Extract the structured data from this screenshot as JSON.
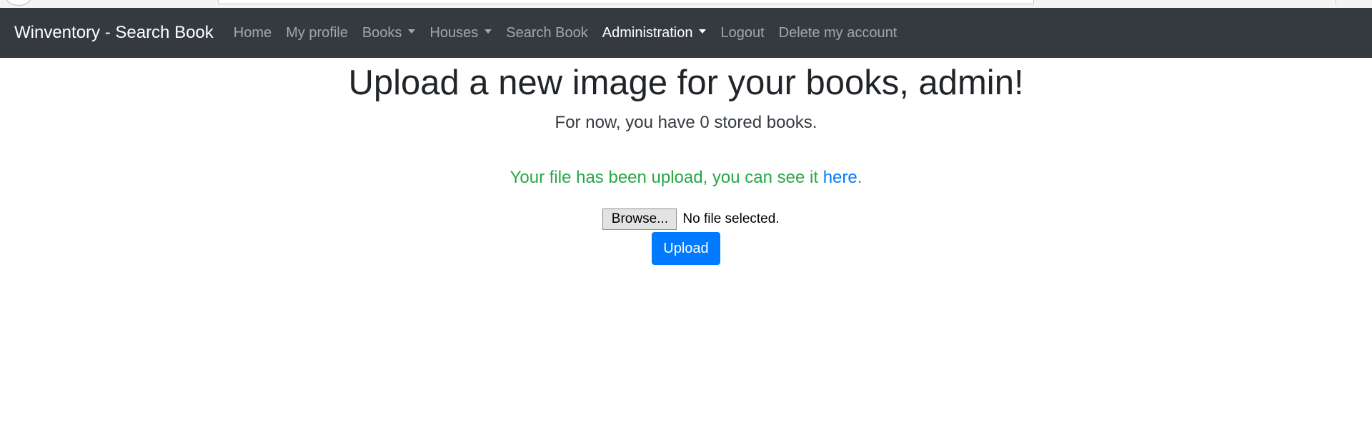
{
  "navbar": {
    "brand": "Winventory - Search Book",
    "items": [
      {
        "label": "Home"
      },
      {
        "label": "My profile"
      },
      {
        "label": "Books"
      },
      {
        "label": "Houses"
      },
      {
        "label": "Search Book"
      },
      {
        "label": "Administration"
      },
      {
        "label": "Logout"
      },
      {
        "label": "Delete my account"
      }
    ]
  },
  "main": {
    "title": "Upload a new image for your books, admin!",
    "lead": "For now, you have 0 stored books.",
    "success_text": "Your file has been upload, you can see it ",
    "success_link": "here",
    "success_end": ".",
    "browse_label": "Browse...",
    "file_status": "No file selected.",
    "upload_label": "Upload"
  },
  "colors": {
    "navbar_bg": "#343a40",
    "success": "#28a745",
    "link": "#007bff",
    "primary_button": "#007bff"
  }
}
